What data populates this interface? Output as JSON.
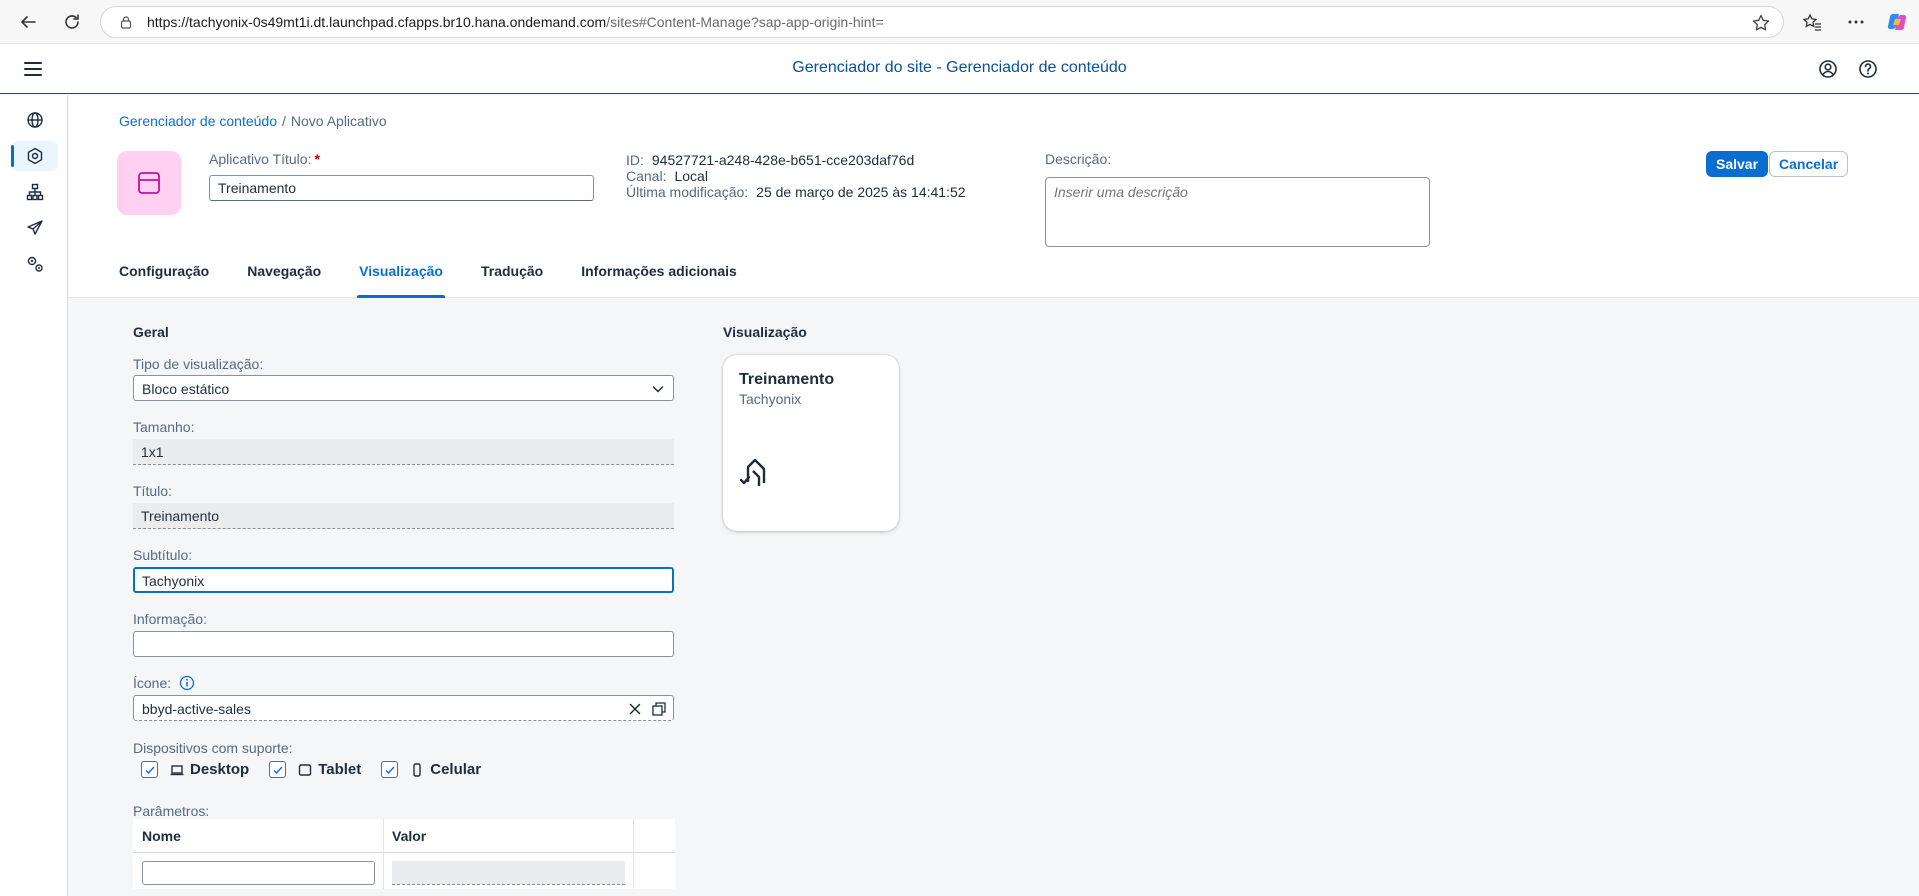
{
  "browser": {
    "url_host": "https://tachyonix-0s49mt1i.dt.launchpad.cfapps.br10.hana.ondemand.com",
    "url_path": "/sites#Content-Manage?sap-app-origin-hint="
  },
  "shell": {
    "title": "Gerenciador do site - Gerenciador de conteúdo"
  },
  "breadcrumb": {
    "link": "Gerenciador de conteúdo",
    "separator": "/",
    "current": "Novo Aplicativo"
  },
  "header": {
    "title_label": "Aplicativo Título:",
    "required_marker": "*",
    "title_value": "Treinamento",
    "meta": [
      {
        "key": "ID:",
        "value": "94527721-a248-428e-b651-cce203daf76d"
      },
      {
        "key": "Canal:",
        "value": "Local"
      },
      {
        "key": "Última modificação:",
        "value": "25 de março de 2025 às 14:41:52"
      }
    ],
    "description_label": "Descrição:",
    "description_placeholder": "Inserir uma descrição",
    "save_label": "Salvar",
    "cancel_label": "Cancelar",
    "avatar_color": "#ffd0f2",
    "accent_color": "#0a6ed1"
  },
  "tabs": [
    {
      "label": "Configuração"
    },
    {
      "label": "Navegação"
    },
    {
      "label": "Visualização",
      "selected": true
    },
    {
      "label": "Tradução"
    },
    {
      "label": "Informações adicionais"
    }
  ],
  "form": {
    "section_title": "Geral",
    "viz_type_label": "Tipo de visualização:",
    "viz_type_value": "Bloco estático",
    "size_label": "Tamanho:",
    "size_value": "1x1",
    "title_label": "Título:",
    "title_value": "Treinamento",
    "subtitle_label": "Subtítulo:",
    "subtitle_value": "Tachyonix",
    "info_label": "Informação:",
    "info_value": "",
    "icon_label": "Ícone:",
    "icon_value": "bbyd-active-sales",
    "devices_label": "Dispositivos com suporte:",
    "devices": [
      {
        "label": "Desktop",
        "checked": true,
        "icon": "laptop-icon"
      },
      {
        "label": "Tablet",
        "checked": true,
        "icon": "tablet-icon"
      },
      {
        "label": "Celular",
        "checked": true,
        "icon": "phone-icon"
      }
    ],
    "params_label": "Parâmetros:",
    "params_columns": [
      "Nome",
      "Valor"
    ]
  },
  "preview": {
    "section_title": "Visualização",
    "tile_title": "Treinamento",
    "tile_subtitle": "Tachyonix",
    "tile_icon": "bbyd-active-sales-icon"
  }
}
